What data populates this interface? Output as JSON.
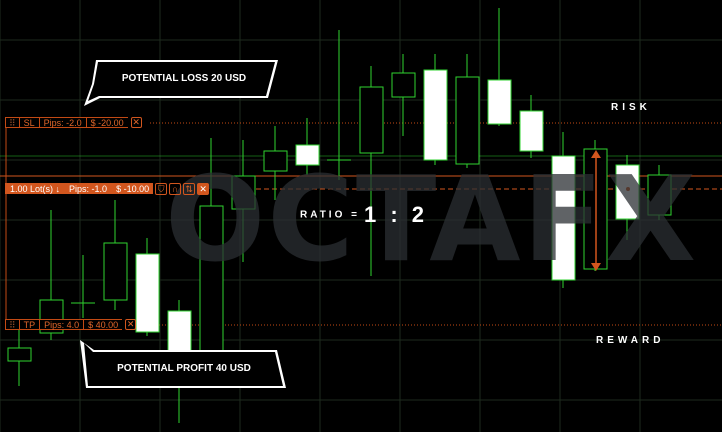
{
  "watermark": "OCTAFX",
  "sl_bar": {
    "grip": "⠿",
    "label": "SL",
    "pips": "Pips: -2.0",
    "amount": "$ -20.00",
    "close": "✕"
  },
  "order_bar": {
    "lots": "1.00 Lot(s)",
    "direction": "↓",
    "pips": "Pips: -1.0",
    "amount": "$ -10.00",
    "close": "✕"
  },
  "tp_bar": {
    "grip": "⠿",
    "label": "TP",
    "pips": "Pips: 4.0",
    "amount": "$ 40.00",
    "close": "✕"
  },
  "callouts": {
    "loss": "POTENTIAL LOSS 20 USD",
    "profit": "POTENTIAL PROFIT 40 USD"
  },
  "labels": {
    "risk": "RISK",
    "reward": "REWARD"
  },
  "ratio": {
    "label": "RATIO =",
    "value": "1 : 2"
  },
  "colors": {
    "bull": "#2fd32f",
    "bear_body": "#ffffff",
    "wick": "#2fd32f",
    "accent": "#d2561e",
    "grid": "#1e2a1e"
  }
}
